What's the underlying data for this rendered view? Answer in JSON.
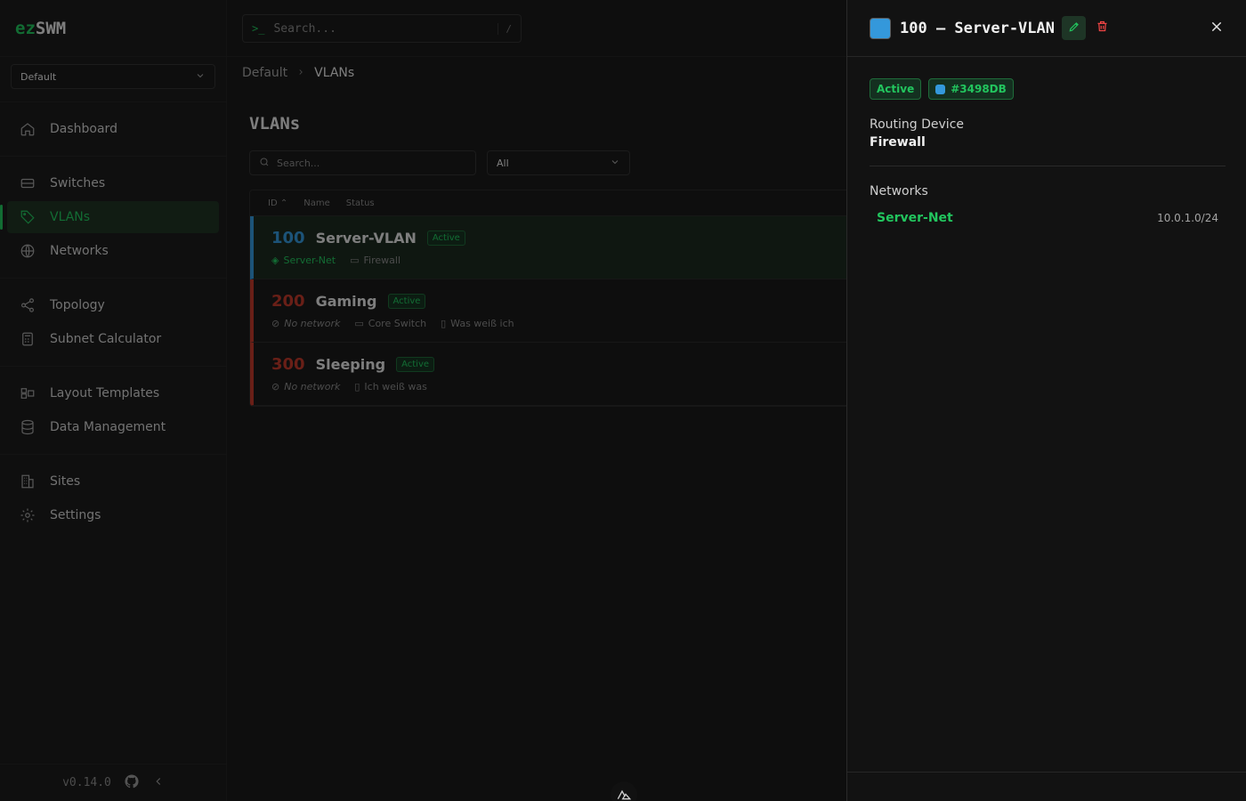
{
  "brand": {
    "prefix": "ez",
    "name": "SWM"
  },
  "site_select": {
    "value": "Default"
  },
  "nav": {
    "dashboard": "Dashboard",
    "switches": "Switches",
    "vlans": "VLANs",
    "networks": "Networks",
    "topology": "Topology",
    "subnet_calculator": "Subnet Calculator",
    "layout_templates": "Layout Templates",
    "data_management": "Data Management",
    "sites": "Sites",
    "settings": "Settings"
  },
  "footer": {
    "version": "v0.14.0"
  },
  "global_search": {
    "prompt": ">_",
    "placeholder": "Search...",
    "shortcut": "/"
  },
  "breadcrumb": {
    "root": "Default",
    "current": "VLANs"
  },
  "page": {
    "title": "VLANs",
    "search_placeholder": "Search...",
    "filter_value": "All",
    "columns": [
      "ID",
      "Name",
      "Status"
    ]
  },
  "vlans": [
    {
      "id": "100",
      "name": "Server-VLAN",
      "status": "Active",
      "network": "Server-Net",
      "device": "Firewall",
      "note": "",
      "color": "#3498DB"
    },
    {
      "id": "200",
      "name": "Gaming",
      "status": "Active",
      "network": "No network",
      "device": "Core Switch",
      "note": "Was weiß ich",
      "color": "#c0392b"
    },
    {
      "id": "300",
      "name": "Sleeping",
      "status": "Active",
      "network": "No network",
      "device": "",
      "note": "Ich weiß was",
      "color": "#c0392b"
    }
  ],
  "drawer": {
    "title": "100 — Server-VLAN",
    "color": "#3498DB",
    "status_badge": "Active",
    "color_badge": "#3498DB",
    "routing_label": "Routing Device",
    "routing_value": "Firewall",
    "networks_label": "Networks",
    "networks": [
      {
        "name": "Server-Net",
        "cidr": "10.0.1.0/24"
      }
    ]
  }
}
